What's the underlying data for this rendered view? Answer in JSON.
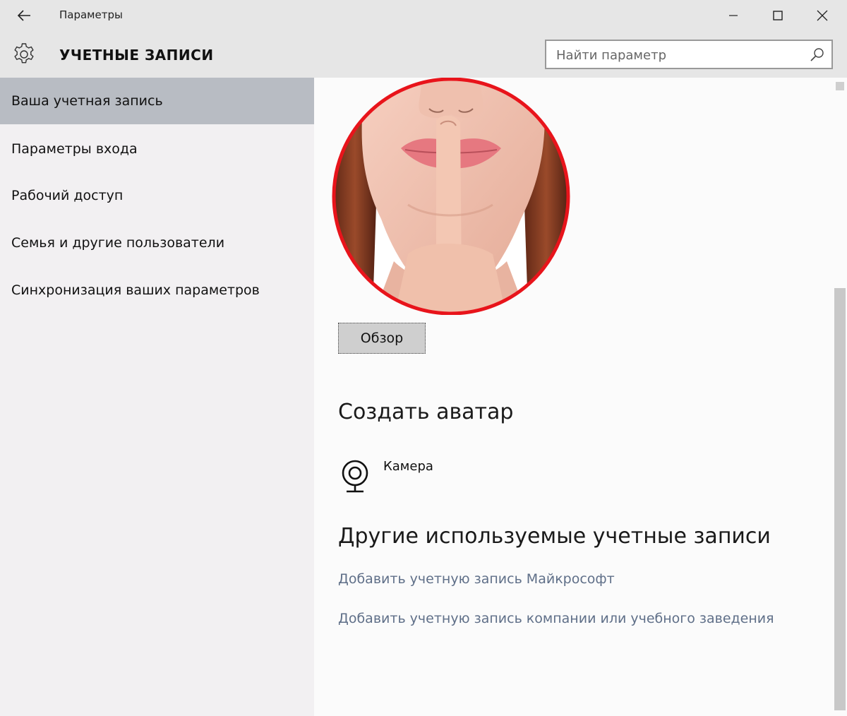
{
  "window": {
    "title": "Параметры"
  },
  "header": {
    "section_title": "УЧЕТНЫЕ ЗАПИСИ",
    "search": {
      "placeholder": "Найти параметр",
      "value": ""
    }
  },
  "sidebar": {
    "items": [
      {
        "label": "Ваша учетная запись",
        "active": true
      },
      {
        "label": "Параметры входа",
        "active": false
      },
      {
        "label": "Рабочий доступ",
        "active": false
      },
      {
        "label": "Семья и другие пользователи",
        "active": false
      },
      {
        "label": "Синхронизация ваших параметров",
        "active": false
      }
    ]
  },
  "main": {
    "browse_button": "Обзор",
    "create_avatar": {
      "heading": "Создать аватар",
      "camera_label": "Камера"
    },
    "other_accounts": {
      "heading": "Другие используемые учетные записи",
      "links": [
        "Добавить учетную запись Майкрософт",
        "Добавить учетную запись компании или учебного заведения"
      ]
    }
  },
  "colors": {
    "sidebar_bg": "#f2f0f2",
    "active_item_bg": "#b8bcc3",
    "header_bg": "#e6e6e6",
    "link": "#5f6f88",
    "avatar_ring": "#e8141b"
  },
  "icons": [
    "back-arrow-icon",
    "minimize-icon",
    "maximize-icon",
    "close-icon",
    "gear-icon",
    "search-icon",
    "webcam-icon"
  ]
}
